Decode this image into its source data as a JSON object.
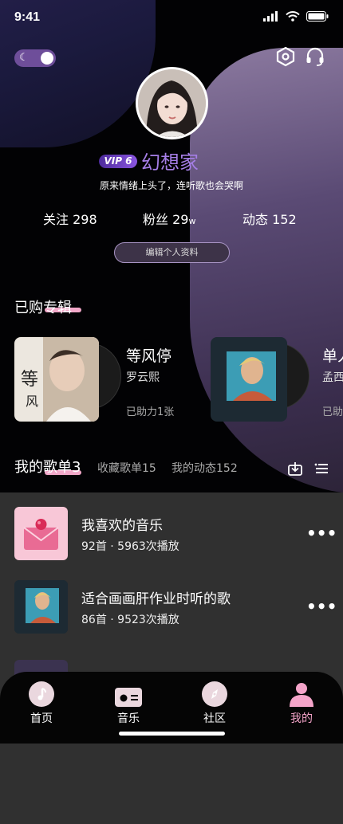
{
  "status_bar": {
    "time": "9:41"
  },
  "profile": {
    "vip": "VIP 6",
    "username": "幻想家",
    "bio": "原来情绪上头了，连听歌也会哭啊",
    "edit_label": "编辑个人资料"
  },
  "stats": [
    {
      "label": "关注",
      "value": "298",
      "unit": ""
    },
    {
      "label": "粉丝",
      "value": "29",
      "unit": "w"
    },
    {
      "label": "动态",
      "value": "152",
      "unit": ""
    }
  ],
  "albums_section": {
    "title": "已购专辑"
  },
  "albums": [
    {
      "name": "等风停",
      "artist": "罗云熙",
      "helped": "已助力1张"
    },
    {
      "name": "单人",
      "artist": "孟西",
      "helped": "已助"
    }
  ],
  "playlist_tabs": {
    "main": "我的歌单3",
    "favorites": "收藏歌单15",
    "moments": "我的动态152"
  },
  "playlists": [
    {
      "title": "我喜欢的音乐",
      "meta": "92首 · 5963次播放"
    },
    {
      "title": "适合画画肝作业时听的歌",
      "meta": "86首 · 9523次播放"
    }
  ],
  "nav": [
    {
      "label": "首页",
      "icon": "music-note-icon"
    },
    {
      "label": "音乐",
      "icon": "radio-icon"
    },
    {
      "label": "社区",
      "icon": "compass-icon"
    },
    {
      "label": "我的",
      "icon": "user-icon"
    }
  ],
  "colors": {
    "accent_purple": "#a57ee6",
    "accent_pink": "#f2a8c9",
    "active_nav": "#f4a4c9"
  }
}
